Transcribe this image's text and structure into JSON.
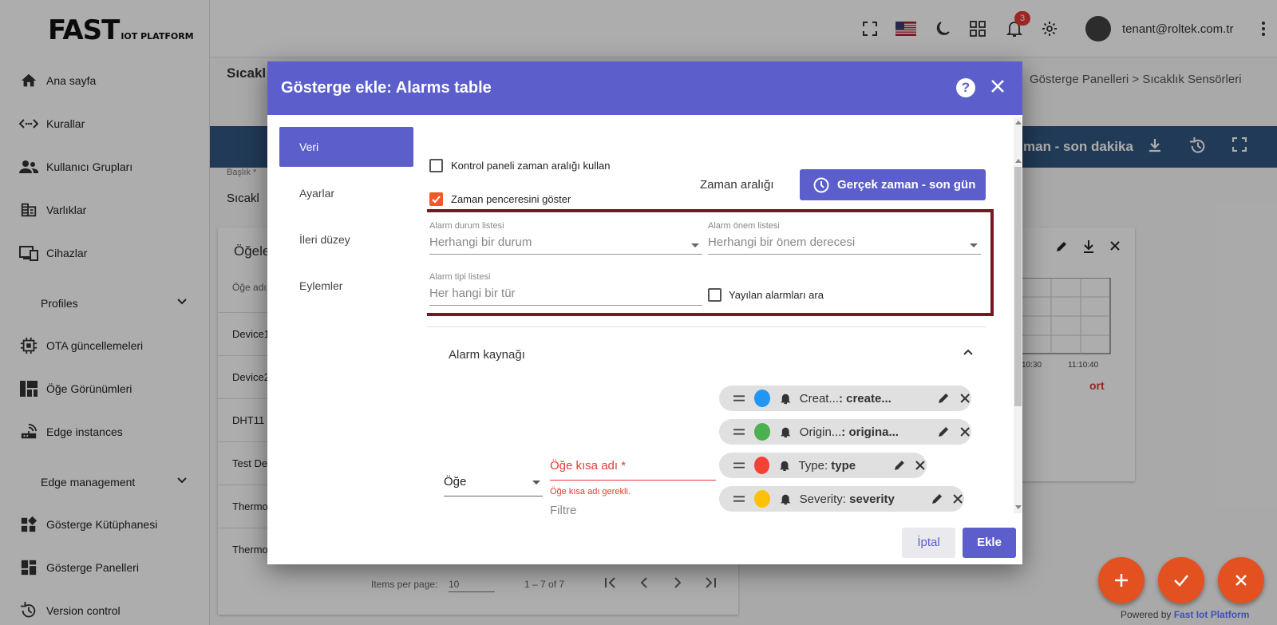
{
  "logo": {
    "main": "FAST",
    "sub": "IOT PLATFORM"
  },
  "sidebar": {
    "items": [
      {
        "label": "Ana sayfa"
      },
      {
        "label": "Kurallar"
      },
      {
        "label": "Kullanıcı Grupları"
      },
      {
        "label": "Varlıklar"
      },
      {
        "label": "Cihazlar"
      },
      {
        "label": "Profiles"
      },
      {
        "label": "OTA güncellemeleri"
      },
      {
        "label": "Öğe Görünümleri"
      },
      {
        "label": "Edge instances"
      },
      {
        "label": "Edge management"
      },
      {
        "label": "Gösterge Kütüphanesi"
      },
      {
        "label": "Gösterge Panelleri"
      },
      {
        "label": "Version control"
      }
    ]
  },
  "topbar": {
    "notification_count": "3",
    "user_email": "tenant@roltek.com.tr"
  },
  "background": {
    "page_title": "Sıcakl",
    "breadcrumb": "Gösterge Panelleri  >  Sıcaklık Sensörleri",
    "dash_bar_text": "man - son dakika",
    "field_label": "Başlık *",
    "field_value": "Sıcakl",
    "card_title": "Öğele",
    "col_header": "Öğe adı",
    "rows": [
      "Device1",
      "Device2",
      "DHT11",
      "Test De",
      "Thermo",
      "Thermo"
    ],
    "items_per_page_label": "Items per page:",
    "items_per_page_value": "10",
    "page_range": "1 – 7 of 7",
    "chart_ticks": [
      "10:30",
      "11:10:40"
    ],
    "chart_partial": "ort"
  },
  "dialog": {
    "title": "Gösterge ekle: Alarms table",
    "tabs": [
      "Veri",
      "Ayarlar",
      "İleri düzey",
      "Eylemler"
    ],
    "use_dashboard_timewindow": "Kontrol paneli zaman aralığı kullan",
    "show_timewindow": "Zaman penceresini göster",
    "time_range_label": "Zaman aralığı",
    "time_range_button": "Gerçek zaman - son gün",
    "alarm_status": {
      "label": "Alarm durum listesi",
      "placeholder": "Herhangi bir durum"
    },
    "alarm_severity": {
      "label": "Alarm önem listesi",
      "placeholder": "Herhangi bir önem derecesi"
    },
    "alarm_type": {
      "label": "Alarm tipi listesi",
      "placeholder": "Her hangi bir tür"
    },
    "search_propagated": "Yayılan alarmları ara",
    "alarm_source": "Alarm kaynağı",
    "entity_select": "Öğe",
    "alias_label": "Öğe kısa adı *",
    "alias_error": "Öğe kısa adı gerekli.",
    "filter_label": "Filtre",
    "keys": [
      {
        "label": "Creat...",
        "key": ": create...",
        "color": "#2196f3"
      },
      {
        "label": "Origin...",
        "key": ": origina...",
        "color": "#4caf50"
      },
      {
        "label": "Type:",
        "key": " type",
        "color": "#f44336"
      },
      {
        "label": "Severity:",
        "key": " severity",
        "color": "#ffc107"
      }
    ],
    "cancel": "İptal",
    "add": "Ekle"
  },
  "footer": {
    "powered_by": "Powered by ",
    "brand": "Fast Iot Platform"
  },
  "colors": {
    "primary": "#5c5fcb",
    "accent": "#ef5a28",
    "highlight": "#7b1621",
    "dash_bar": "#305680"
  }
}
